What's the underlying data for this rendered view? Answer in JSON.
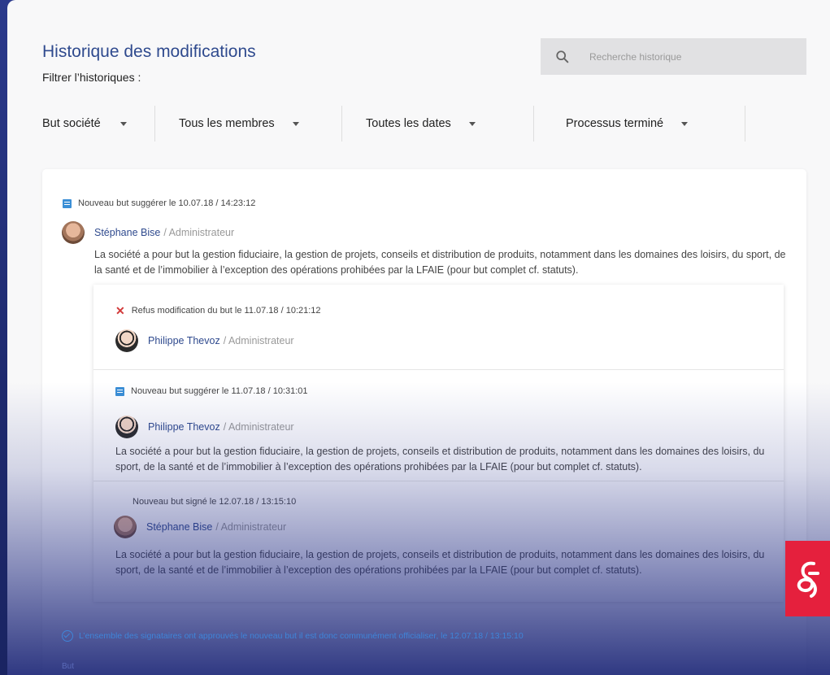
{
  "header": {
    "title": "Historique des modifications",
    "filter_label": "Filtrer l’historiques :",
    "search_placeholder": "Recherche historique",
    "search_icon": "search-icon"
  },
  "filters": [
    {
      "label": "But société"
    },
    {
      "label": "Tous les membres"
    },
    {
      "label": "Toutes les dates"
    },
    {
      "label": "Processus terminé"
    }
  ],
  "entry1": {
    "meta": "Nouveau but suggérer le 10.07.18 / 14:23:12",
    "user_name": "Stéphane Bise",
    "user_role": "/ Administrateur",
    "text": "La société a pour but la gestion fiduciaire, la gestion de projets, conseils et distribution de produits, notamment dans les domaines des loisirs, du sport, de la santé et de l’immobilier à l’exception des opérations prohibées par la LFAIE (pour but complet cf. statuts)."
  },
  "sub_entries": [
    {
      "meta": "Refus modification du but le 11.07.18 / 10:21:12",
      "user_name": "Philippe Thevoz",
      "user_role": "/ Administrateur"
    },
    {
      "meta": "Nouveau but suggérer le 11.07.18 / 10:31:01",
      "user_name": "Philippe Thevoz",
      "user_role": "/ Administrateur",
      "text": "La société a pour but la gestion fiduciaire, la gestion de projets, conseils et distribution de produits, notamment dans les domaines des loisirs, du sport, de la santé et de l’immobilier à l’exception des opérations prohibées par la LFAIE (pour but complet cf. statuts)."
    },
    {
      "meta": "Nouveau but signé le 12.07.18 / 13:15:10",
      "user_name": "Stéphane Bise",
      "user_role": "/ Administrateur",
      "text": "La société a pour but la gestion fiduciaire, la gestion de projets, conseils et distribution de produits, notamment dans les domaines des loisirs, du sport, de la santé et de l’immobilier à l’exception des opérations prohibées par la LFAIE (pour but complet cf. statuts)."
    }
  ],
  "final_status": "L’ensemble des signataires ont approuvés le nouveau but il est donc communément officialiser, le 12.07.18 / 13:15:10",
  "bottom_label": "But",
  "colors": {
    "accent": "#2f4a8e",
    "doc_icon": "#3b8fd6",
    "refuse": "#d23a3a",
    "brand_logo": "#e5203d"
  }
}
